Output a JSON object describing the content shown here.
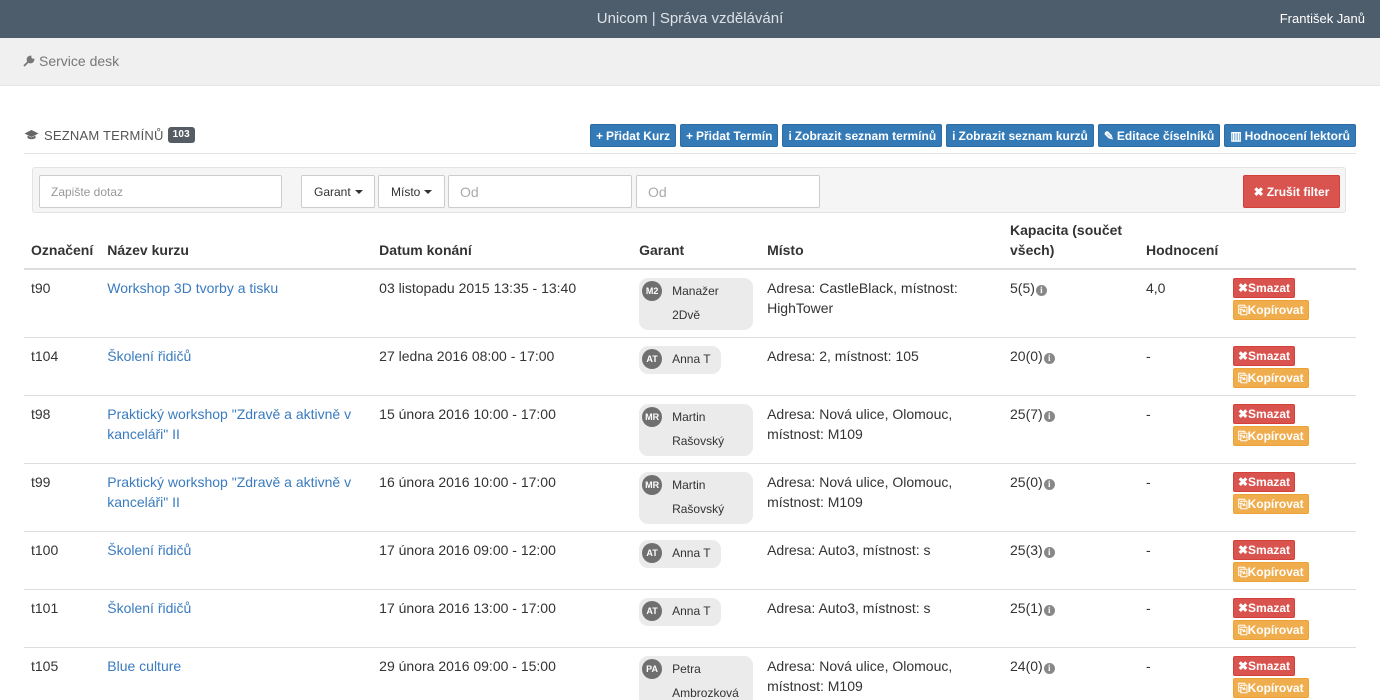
{
  "topbar": {
    "title": "Unicom | Správa vzdělávání",
    "user": "František Janů"
  },
  "subbar": {
    "crumb": "Service desk"
  },
  "section": {
    "title": "SEZNAM TERMÍNŮ",
    "count": "103"
  },
  "actions": [
    {
      "label": "Přidat Kurz",
      "icon": "+"
    },
    {
      "label": "Přidat Termín",
      "icon": "+"
    },
    {
      "label": "Zobrazit seznam termínů",
      "icon": "i"
    },
    {
      "label": "Zobrazit seznam kurzů",
      "icon": "i"
    },
    {
      "label": "Editace číselníků",
      "icon": "✎"
    },
    {
      "label": "Hodnocení lektorů",
      "icon": "▥"
    }
  ],
  "filter": {
    "query_placeholder": "Zapište dotaz",
    "garant": "Garant",
    "misto": "Místo",
    "od1": "Od",
    "od2": "Od",
    "clear": "Zrušit filter"
  },
  "table": {
    "headers": [
      "Označení",
      "Název kurzu",
      "Datum konání",
      "Garant",
      "Místo",
      "Kapacita (součet všech)",
      "Hodnocení",
      ""
    ],
    "delete_label": "Smazat",
    "copy_label": "Kopírovat",
    "rows": [
      {
        "id": "t90",
        "name": "Workshop 3D tvorby a tisku",
        "date": "03 listopadu 2015 13:35 - 13:40",
        "initials": "M2",
        "garant": "Manažer 2Dvě",
        "place": "Adresa: CastleBlack, místnost: HighTower",
        "capacity": "5(5)",
        "rating": "4,0"
      },
      {
        "id": "t104",
        "name": "Školení řidičů",
        "date": "27 ledna 2016 08:00 - 17:00",
        "initials": "AT",
        "garant": "Anna T",
        "place": "Adresa: 2, místnost: 105",
        "capacity": "20(0)",
        "rating": "-"
      },
      {
        "id": "t98",
        "name": "Praktický workshop \"Zdravě a aktivně v kanceláři\" II",
        "date": "15 února 2016 10:00 - 17:00",
        "initials": "MR",
        "garant": "Martin Rašovský",
        "place": "Adresa: Nová ulice, Olomouc, místnost: M109",
        "capacity": "25(7)",
        "rating": "-"
      },
      {
        "id": "t99",
        "name": "Praktický workshop \"Zdravě a aktivně v kanceláři\" II",
        "date": "16 února 2016 10:00 - 17:00",
        "initials": "MR",
        "garant": "Martin Rašovský",
        "place": "Adresa: Nová ulice, Olomouc, místnost: M109",
        "capacity": "25(0)",
        "rating": "-"
      },
      {
        "id": "t100",
        "name": "Školení řidičů",
        "date": "17 února 2016 09:00 - 12:00",
        "initials": "AT",
        "garant": "Anna T",
        "place": "Adresa: Auto3, místnost: s",
        "capacity": "25(3)",
        "rating": "-"
      },
      {
        "id": "t101",
        "name": "Školení řidičů",
        "date": "17 února 2016 13:00 - 17:00",
        "initials": "AT",
        "garant": "Anna T",
        "place": "Adresa: Auto3, místnost: s",
        "capacity": "25(1)",
        "rating": "-"
      },
      {
        "id": "t105",
        "name": "Blue culture",
        "date": "29 února 2016 09:00 - 15:00",
        "initials": "PA",
        "garant": "Petra Ambrozková",
        "place": "Adresa: Nová ulice, Olomouc, místnost: M109",
        "capacity": "24(0)",
        "rating": "-"
      }
    ]
  }
}
